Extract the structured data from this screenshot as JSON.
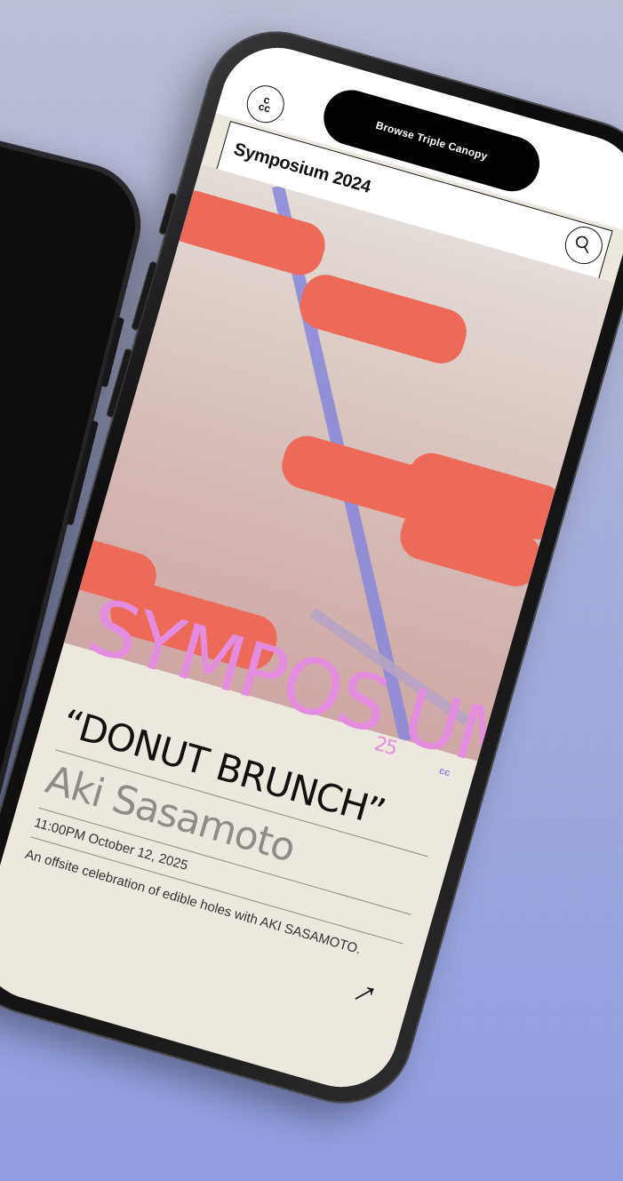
{
  "app": {
    "status_island_text": "Browse Triple Canopy",
    "logo_text_top": "c",
    "logo_text_bottom": "cc",
    "page_title": "Symposium 2024",
    "controls": {
      "expand": "⌄",
      "close": "×"
    }
  },
  "wordmark": {
    "text": "SYMPOS",
    "tail": "UM",
    "sub": "25",
    "small_mark": "cc"
  },
  "event": {
    "title": "“DONUT BRUNCH”",
    "host": "Aki Sasamoto",
    "time": "11:00PM October 12, 2025",
    "description": "An offsite celebration of edible holes with AKI SASAMOTO."
  },
  "colors": {
    "accent_pink": "#e38ce0",
    "shape_red": "#ec6a57",
    "stripe_purple": "#8b8ad9",
    "screen_bg": "#ece8dd"
  }
}
